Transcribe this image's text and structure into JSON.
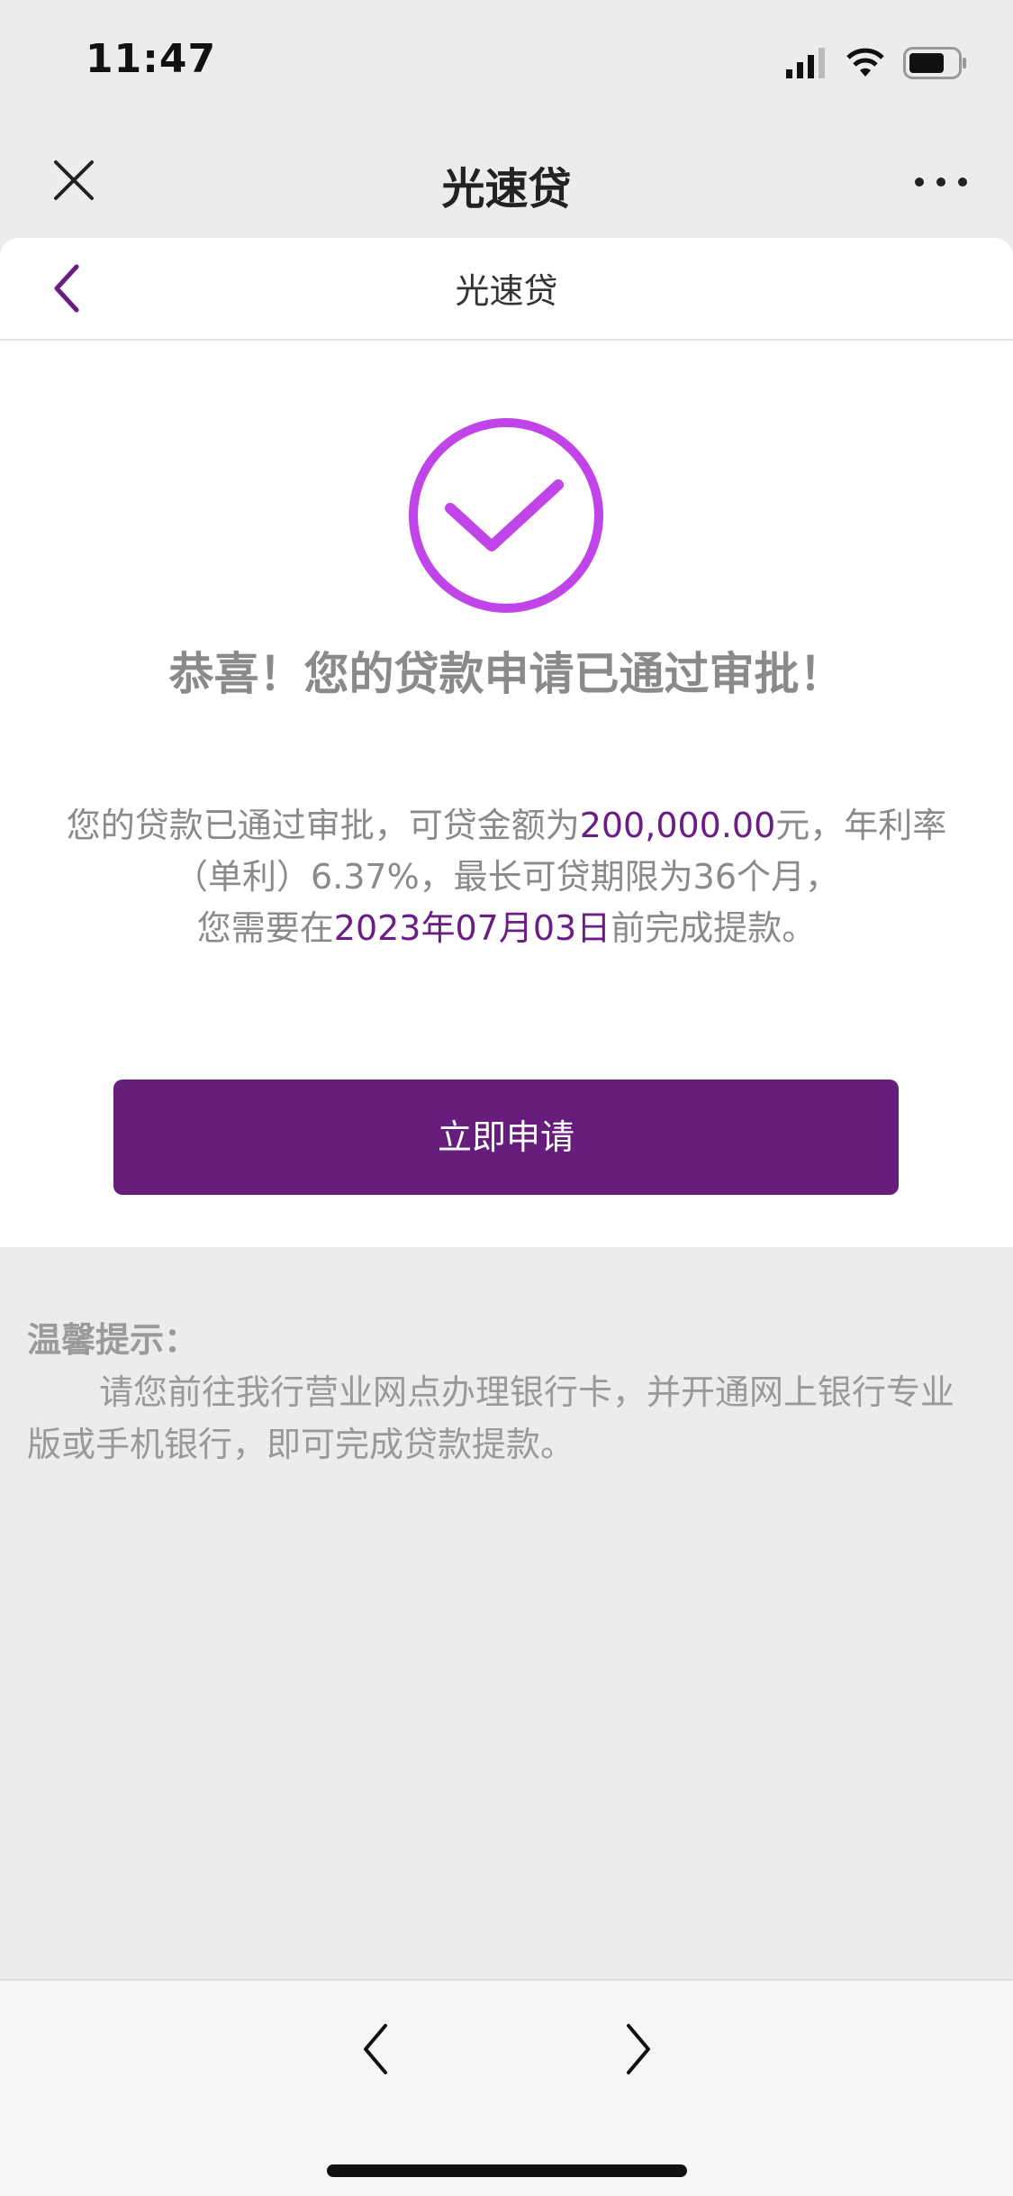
{
  "status": {
    "time": "11:47"
  },
  "nav": {
    "title": "光速贷"
  },
  "sub_header": {
    "title": "光速贷"
  },
  "result": {
    "headline": "恭喜！您的贷款申请已通过审批！"
  },
  "description": {
    "part1": "您的贷款已通过审批，可贷金额为",
    "amount": "200,000.00",
    "part2": "元，年利率（单利）6.37%，最长可贷期限为36个月，",
    "part3": "您需要在",
    "deadline": "2023年07月03日",
    "part4": "前完成提款。"
  },
  "apply_button": {
    "label": "立即申请"
  },
  "tips": {
    "title": "温馨提示：",
    "body": "请您前往我行营业网点办理银行卡，并开通网上银行专业版或手机银行，即可完成贷款提款。"
  },
  "colors": {
    "accent": "#661d7c",
    "check": "#c044e8"
  },
  "icons": [
    "signal-icon",
    "wifi-icon",
    "battery-icon",
    "close-icon",
    "more-icon",
    "back-icon",
    "check-circle-icon",
    "prev-icon",
    "next-icon"
  ]
}
